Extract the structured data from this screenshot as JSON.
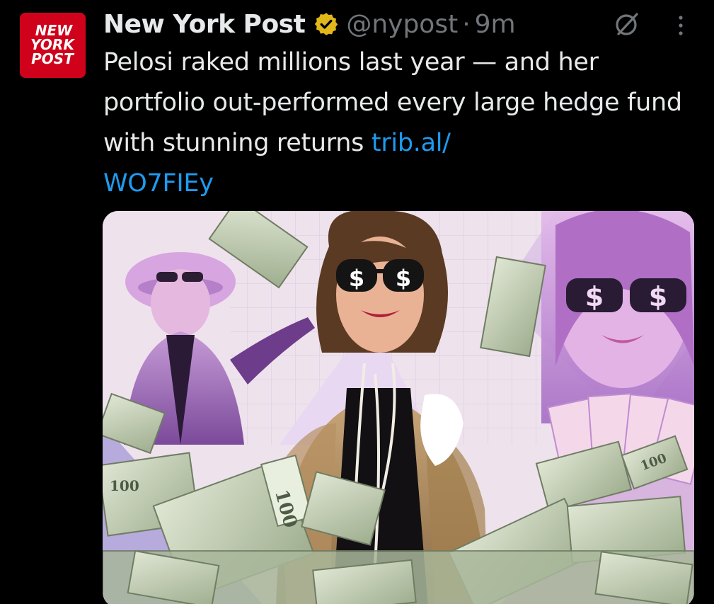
{
  "author": {
    "name": "New York Post",
    "handle": "@nypost",
    "separator": "·",
    "time": "9m",
    "avatar_lines": [
      "NEW",
      "YORK",
      "POST"
    ],
    "verified_color": "#e2b719",
    "avatar_color": "#d0021b"
  },
  "tweet": {
    "text": "Pelosi raked millions last year — and her portfolio out-performed every large hedge fund with stunning returns ",
    "link_part1": "trib.al/",
    "link_part2": "WO7FIEy",
    "link_color": "#1d9bf0"
  },
  "actions": {
    "grok_icon": "grok-icon",
    "more_icon": "more-icon"
  },
  "media": {
    "description_icon": "photo",
    "bill_label": "100",
    "glasses_symbol": "$"
  }
}
